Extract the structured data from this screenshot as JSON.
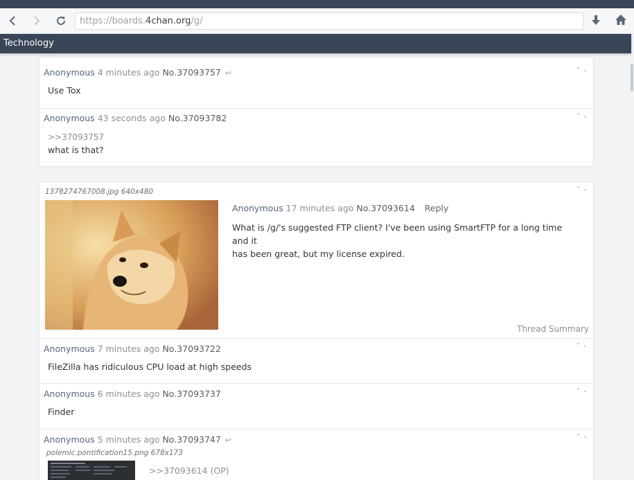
{
  "browser": {
    "url_scheme": "https://boards.",
    "url_host": "4chan.org",
    "url_path": "/g/"
  },
  "board": {
    "title": "Technology"
  },
  "posts_top": [
    {
      "name": "Anonymous",
      "time": "4 minutes ago",
      "number": "No.37093757",
      "body": "Use Tox",
      "menu": "˅ -"
    },
    {
      "name": "Anonymous",
      "time": "43 seconds ago",
      "number": "No.37093782",
      "quote": ">>37093757",
      "body": "what is that?",
      "menu": "˅ -"
    }
  ],
  "thread": {
    "file_info": "1378274767008.jpg 640x480",
    "op": {
      "name": "Anonymous",
      "time": "17 minutes ago",
      "number": "No.37093614",
      "reply_label": "Reply",
      "body_line1": "What is /g/'s suggested FTP client? I've been using SmartFTP for a long time and it",
      "body_line2": "has been great, but my license expired.",
      "menu": "˅ -"
    },
    "summary_label": "Thread Summary",
    "replies": [
      {
        "name": "Anonymous",
        "time": "7 minutes ago",
        "number": "No.37093722",
        "body": "FileZilla has ridiculous CPU load at high speeds",
        "menu": "˅ -"
      },
      {
        "name": "Anonymous",
        "time": "6 minutes ago",
        "number": "No.37093737",
        "body": "Finder",
        "menu": "˅ -"
      },
      {
        "name": "Anonymous",
        "time": "5 minutes ago",
        "number": "No.37093747",
        "file_info": "polemic.pontification15.png 678x173",
        "quote": ">>37093614 (OP)",
        "menu": "˅ -"
      }
    ]
  },
  "icons": {
    "back": "back-arrow-icon",
    "forward": "forward-arrow-icon",
    "reload": "reload-icon",
    "download": "download-arrow-icon",
    "home": "home-icon",
    "reply_arrow": "reply-arrow-icon"
  },
  "colors": {
    "header_bg": "#3a4557",
    "name": "#53657b",
    "page_bg": "#f2f3f5"
  }
}
